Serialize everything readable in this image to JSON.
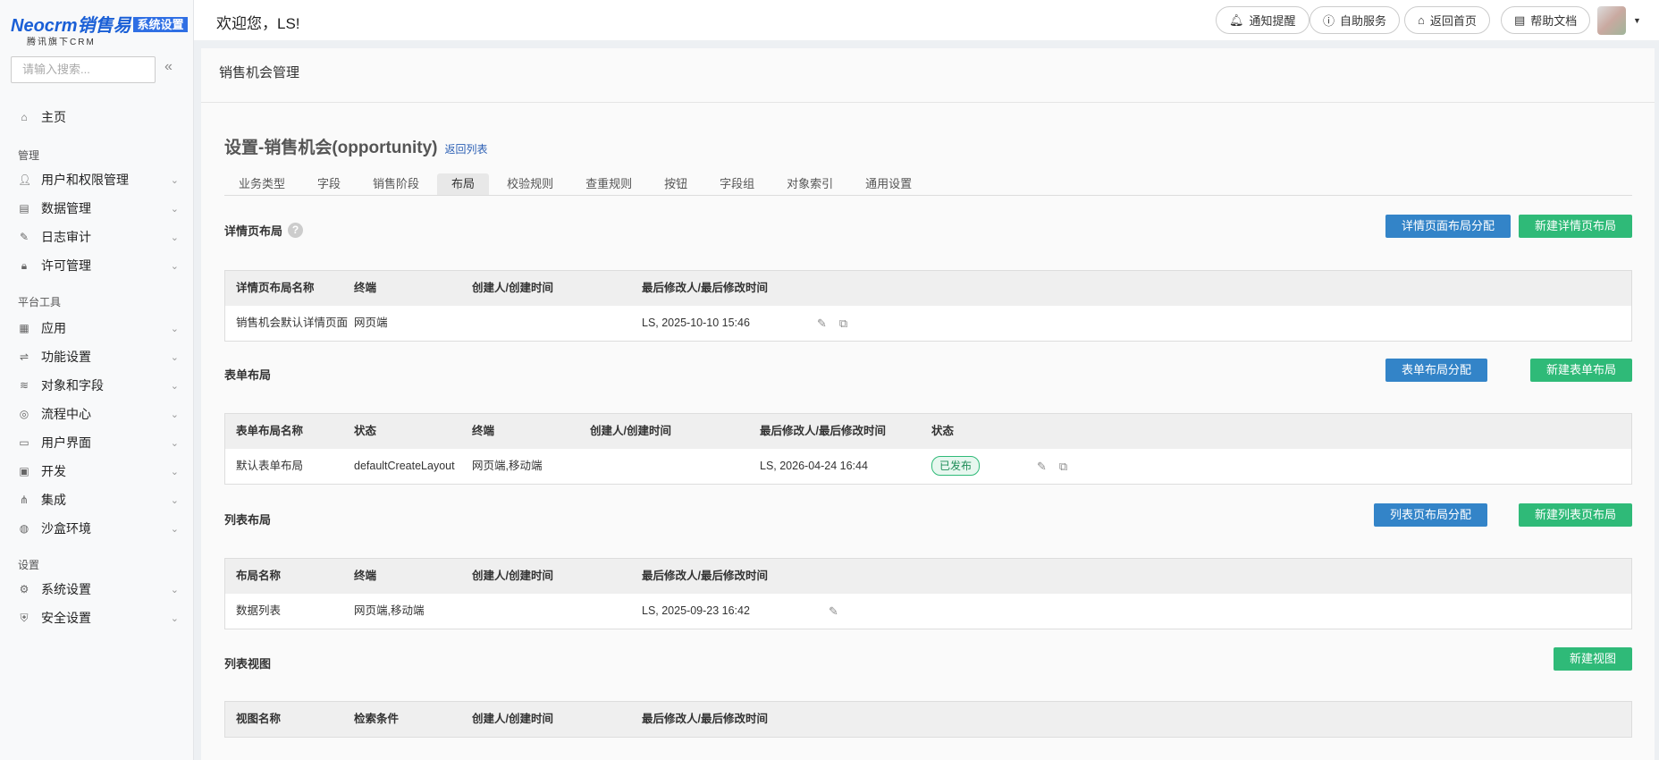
{
  "brand": {
    "logo": "Neocrm销售易",
    "badge": "系统设置",
    "sub": "腾讯旗下CRM"
  },
  "sidebar": {
    "search_placeholder": "请输入搜索...",
    "home": "主页",
    "groups": [
      {
        "label": "管理",
        "items": [
          "用户和权限管理",
          "数据管理",
          "日志审计",
          "许可管理"
        ]
      },
      {
        "label": "平台工具",
        "items": [
          "应用",
          "功能设置",
          "对象和字段",
          "流程中心",
          "用户界面",
          "开发",
          "集成",
          "沙盒环境"
        ]
      },
      {
        "label": "设置",
        "items": [
          "系统设置",
          "安全设置"
        ]
      }
    ]
  },
  "topbar": {
    "welcome": "欢迎您，LS!",
    "buttons": [
      "通知提醒",
      "自助服务",
      "返回首页",
      "帮助文档"
    ]
  },
  "page": {
    "card_title": "销售机会管理",
    "title": "设置-销售机会(opportunity)",
    "back_link": "返回列表",
    "tabs": [
      "业务类型",
      "字段",
      "销售阶段",
      "布局",
      "校验规则",
      "查重规则",
      "按钮",
      "字段组",
      "对象索引",
      "通用设置"
    ],
    "active_tab": "布局"
  },
  "detail": {
    "title": "详情页布局",
    "btn_assign": "详情页面布局分配",
    "btn_new": "新建详情页布局",
    "headers": [
      "详情页布局名称",
      "终端",
      "创建人/创建时间",
      "最后修改人/最后修改时间"
    ],
    "rows": [
      [
        "销售机会默认详情页面",
        "网页端",
        "",
        "LS, 2025-10-10 15:46"
      ]
    ]
  },
  "form": {
    "title": "表单布局",
    "btn_assign": "表单布局分配",
    "btn_new": "新建表单布局",
    "headers": [
      "表单布局名称",
      "状态",
      "终端",
      "创建人/创建时间",
      "最后修改人/最后修改时间",
      "状态"
    ],
    "rows": [
      [
        "默认表单布局",
        "defaultCreateLayout",
        "网页端,移动端",
        "",
        "LS, 2026-04-24 16:44",
        "已发布"
      ]
    ]
  },
  "list": {
    "title": "列表布局",
    "btn_assign": "列表页布局分配",
    "btn_new": "新建列表页布局",
    "headers": [
      "布局名称",
      "终端",
      "创建人/创建时间",
      "最后修改人/最后修改时间"
    ],
    "rows": [
      [
        "数据列表",
        "网页端,移动端",
        "",
        "LS, 2025-09-23 16:42"
      ]
    ]
  },
  "views": {
    "title": "列表视图",
    "btn_new": "新建视图",
    "headers": [
      "视图名称",
      "检索条件",
      "创建人/创建时间",
      "最后修改人/最后修改时间"
    ]
  },
  "colors": {
    "primary": "#3384c8",
    "success": "#2fba78"
  }
}
